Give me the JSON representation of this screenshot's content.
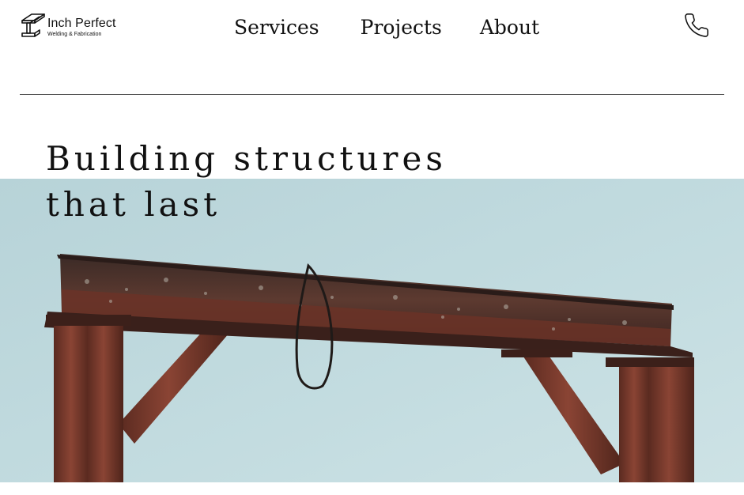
{
  "brand": {
    "name": "Inch Perfect",
    "tagline": "Welding & Fabrication",
    "icon": "i-beam-logo-icon"
  },
  "nav": {
    "items": [
      {
        "label": "Services"
      },
      {
        "label": "Projects"
      },
      {
        "label": "About"
      }
    ],
    "phone_icon": "phone-icon"
  },
  "hero": {
    "headline_line1": "Building structures",
    "headline_line2": "that last",
    "image": "rusted-steel-beam-frame-against-sky"
  },
  "colors": {
    "sky": "#bcd9de",
    "rust": "#7d3b2b",
    "text": "#111111",
    "background": "#ffffff"
  }
}
